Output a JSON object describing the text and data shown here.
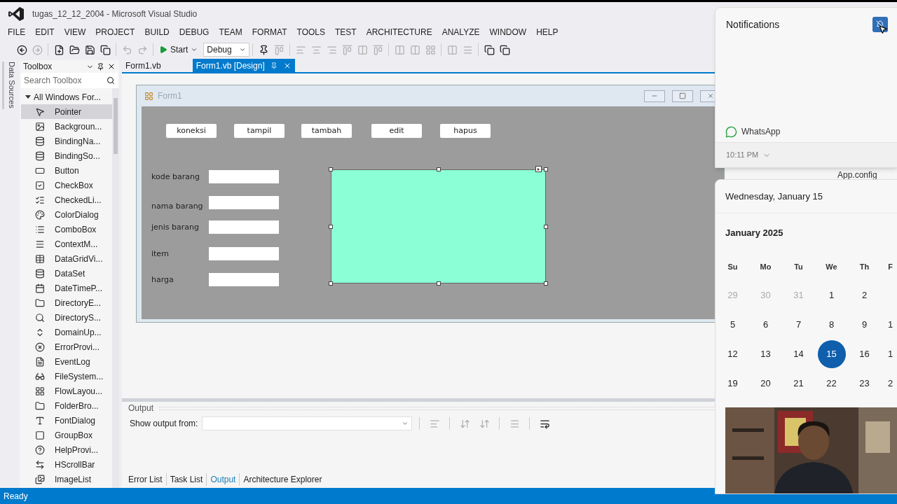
{
  "window": {
    "title": "tugas_12_12_2004 - Microsoft Visual Studio"
  },
  "menu": [
    "FILE",
    "EDIT",
    "VIEW",
    "PROJECT",
    "BUILD",
    "DEBUG",
    "TEAM",
    "FORMAT",
    "TOOLS",
    "TEST",
    "ARCHITECTURE",
    "ANALYZE",
    "WINDOW",
    "HELP"
  ],
  "toolbar": {
    "start": "Start",
    "configuration": "Debug"
  },
  "side_tab": "Data Sources",
  "toolbox": {
    "title": "Toolbox",
    "search_placeholder": "Search Toolbox",
    "group": "All Windows For...",
    "items": [
      {
        "label": "Pointer",
        "selected": true
      },
      {
        "label": "Backgroun...",
        "selected": false
      },
      {
        "label": "BindingNa...",
        "selected": false
      },
      {
        "label": "BindingSo...",
        "selected": false
      },
      {
        "label": "Button",
        "selected": false
      },
      {
        "label": "CheckBox",
        "selected": false
      },
      {
        "label": "CheckedLi...",
        "selected": false
      },
      {
        "label": "ColorDialog",
        "selected": false
      },
      {
        "label": "ComboBox",
        "selected": false
      },
      {
        "label": "ContextM...",
        "selected": false
      },
      {
        "label": "DataGridVi...",
        "selected": false
      },
      {
        "label": "DataSet",
        "selected": false
      },
      {
        "label": "DateTimeP...",
        "selected": false
      },
      {
        "label": "DirectoryE...",
        "selected": false
      },
      {
        "label": "DirectoryS...",
        "selected": false
      },
      {
        "label": "DomainUp...",
        "selected": false
      },
      {
        "label": "ErrorProvi...",
        "selected": false
      },
      {
        "label": "EventLog",
        "selected": false
      },
      {
        "label": "FileSystem...",
        "selected": false
      },
      {
        "label": "FlowLayou...",
        "selected": false
      },
      {
        "label": "FolderBro...",
        "selected": false
      },
      {
        "label": "FontDialog",
        "selected": false
      },
      {
        "label": "GroupBox",
        "selected": false
      },
      {
        "label": "HelpProvi...",
        "selected": false
      },
      {
        "label": "HScrollBar",
        "selected": false
      },
      {
        "label": "ImageList",
        "selected": false
      }
    ]
  },
  "document_tabs": [
    {
      "label": "Form1.vb",
      "selected": false
    },
    {
      "label": "Form1.vb [Design]",
      "selected": true
    }
  ],
  "form": {
    "title": "Form1",
    "buttons": [
      "koneksi",
      "tampil",
      "tambah",
      "edit",
      "hapus"
    ],
    "fields": [
      {
        "label": "kode barang"
      },
      {
        "label": "nama barang"
      },
      {
        "label": "jenis barang"
      },
      {
        "label": "item"
      },
      {
        "label": "harga"
      }
    ]
  },
  "output": {
    "title": "Output",
    "show_from": "Show output from:",
    "tabs": [
      {
        "label": "Error List",
        "selected": false
      },
      {
        "label": "Task List",
        "selected": false
      },
      {
        "label": "Output",
        "selected": true
      },
      {
        "label": "Architecture Explorer",
        "selected": false
      }
    ]
  },
  "status_bar": "Ready",
  "background_item": "App.config",
  "notifications": {
    "title": "Notifications",
    "app": "WhatsApp",
    "time": "10:11 PM"
  },
  "calendar": {
    "date": "Wednesday, January 15",
    "month": "January 2025",
    "weekdays": [
      "Su",
      "Mo",
      "Tu",
      "We",
      "Th",
      "F"
    ],
    "weeks": [
      [
        {
          "day": "29",
          "muted": true,
          "selected": false
        },
        {
          "day": "30",
          "muted": true,
          "selected": false
        },
        {
          "day": "31",
          "muted": true,
          "selected": false
        },
        {
          "day": "1",
          "muted": false,
          "selected": false
        },
        {
          "day": "2",
          "muted": false,
          "selected": false
        }
      ],
      [
        {
          "day": "5",
          "muted": false,
          "selected": false
        },
        {
          "day": "6",
          "muted": false,
          "selected": false
        },
        {
          "day": "7",
          "muted": false,
          "selected": false
        },
        {
          "day": "8",
          "muted": false,
          "selected": false
        },
        {
          "day": "9",
          "muted": false,
          "selected": false
        },
        {
          "day": "1",
          "muted": false,
          "selected": false
        }
      ],
      [
        {
          "day": "12",
          "muted": false,
          "selected": false
        },
        {
          "day": "13",
          "muted": false,
          "selected": false
        },
        {
          "day": "14",
          "muted": false,
          "selected": false
        },
        {
          "day": "15",
          "muted": false,
          "selected": true
        },
        {
          "day": "16",
          "muted": false,
          "selected": false
        },
        {
          "day": "1",
          "muted": false,
          "selected": false
        }
      ],
      [
        {
          "day": "19",
          "muted": false,
          "selected": false
        },
        {
          "day": "20",
          "muted": false,
          "selected": false
        },
        {
          "day": "21",
          "muted": false,
          "selected": false
        },
        {
          "day": "22",
          "muted": false,
          "selected": false
        },
        {
          "day": "23",
          "muted": false,
          "selected": false
        },
        {
          "day": "2",
          "muted": false,
          "selected": false
        }
      ]
    ]
  }
}
